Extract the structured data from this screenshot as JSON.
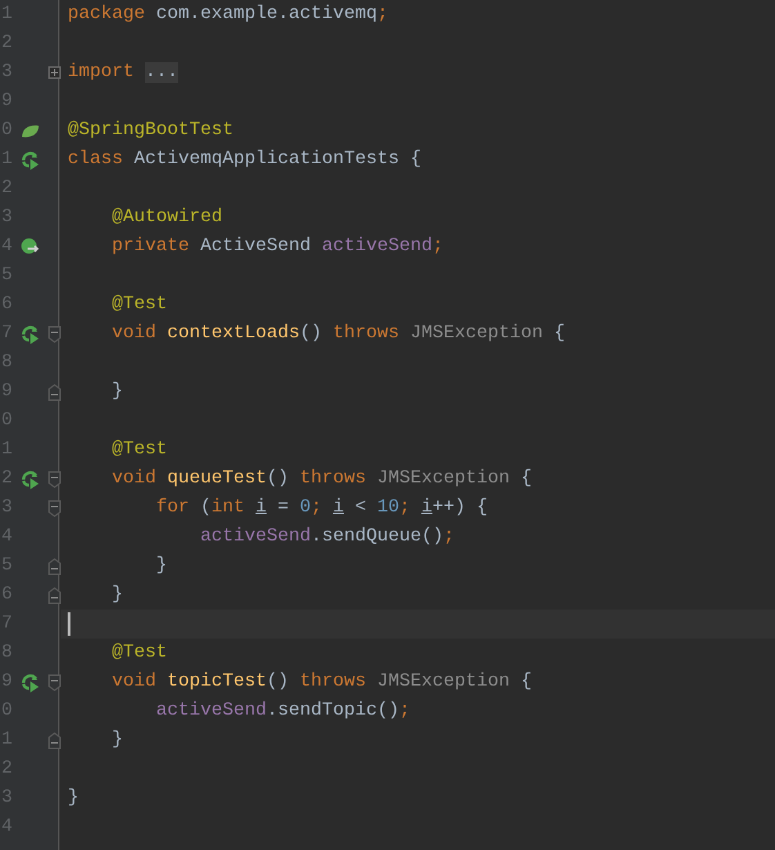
{
  "editor": {
    "lines": [
      {
        "number": "1",
        "tokens": [
          {
            "text": "package ",
            "kind": "keyword"
          },
          {
            "text": "com.example.activemq",
            "kind": "plain"
          },
          {
            "text": ";",
            "kind": "keyword"
          }
        ]
      },
      {
        "number": "2"
      },
      {
        "number": "3",
        "fold": {
          "kind": "plus"
        },
        "tokens": [
          {
            "text": "import ",
            "kind": "keyword"
          },
          {
            "text": "...",
            "kind": "folded"
          }
        ]
      },
      {
        "number": "9"
      },
      {
        "number": "0",
        "gutter": {
          "kind": "spring"
        },
        "tokens": [
          {
            "text": "@SpringBootTest",
            "kind": "annotation"
          }
        ]
      },
      {
        "number": "1",
        "gutter": {
          "kind": "run"
        },
        "tokens": [
          {
            "text": "class ",
            "kind": "keyword"
          },
          {
            "text": "ActivemqApplicationTests {",
            "kind": "plain"
          }
        ]
      },
      {
        "number": "2"
      },
      {
        "number": "3",
        "tokens": [
          {
            "text": "    @Autowired",
            "kind": "annotation"
          }
        ]
      },
      {
        "number": "4",
        "gutter": {
          "kind": "autowired"
        },
        "tokens": [
          {
            "text": "    private ",
            "kind": "keyword"
          },
          {
            "text": "ActiveSend ",
            "kind": "plain"
          },
          {
            "text": "activeSend",
            "kind": "field"
          },
          {
            "text": ";",
            "kind": "keyword"
          }
        ]
      },
      {
        "number": "5"
      },
      {
        "number": "6",
        "tokens": [
          {
            "text": "    @Test",
            "kind": "annotation"
          }
        ]
      },
      {
        "number": "7",
        "gutter": {
          "kind": "run"
        },
        "fold": {
          "kind": "start"
        },
        "tokens": [
          {
            "text": "    void ",
            "kind": "keyword"
          },
          {
            "text": "contextLoads",
            "kind": "method"
          },
          {
            "text": "() ",
            "kind": "plain"
          },
          {
            "text": "throws ",
            "kind": "keyword"
          },
          {
            "text": "JMSException",
            "kind": "unresolved"
          },
          {
            "text": " {",
            "kind": "plain"
          }
        ]
      },
      {
        "number": "8"
      },
      {
        "number": "9",
        "fold": {
          "kind": "end"
        },
        "tokens": [
          {
            "text": "    }",
            "kind": "plain"
          }
        ]
      },
      {
        "number": "0"
      },
      {
        "number": "1",
        "tokens": [
          {
            "text": "    @Test",
            "kind": "annotation"
          }
        ]
      },
      {
        "number": "2",
        "gutter": {
          "kind": "run"
        },
        "fold": {
          "kind": "start"
        },
        "tokens": [
          {
            "text": "    void ",
            "kind": "keyword"
          },
          {
            "text": "queueTest",
            "kind": "method"
          },
          {
            "text": "() ",
            "kind": "plain"
          },
          {
            "text": "throws ",
            "kind": "keyword"
          },
          {
            "text": "JMSException",
            "kind": "unresolved"
          },
          {
            "text": " {",
            "kind": "plain"
          }
        ]
      },
      {
        "number": "3",
        "fold": {
          "kind": "start"
        },
        "tokens": [
          {
            "text": "        for ",
            "kind": "keyword"
          },
          {
            "text": "(",
            "kind": "plain"
          },
          {
            "text": "int ",
            "kind": "keyword"
          },
          {
            "text": "i",
            "kind": "reassigned"
          },
          {
            "text": " = ",
            "kind": "plain"
          },
          {
            "text": "0",
            "kind": "number"
          },
          {
            "text": "; ",
            "kind": "keyword"
          },
          {
            "text": "i",
            "kind": "reassigned"
          },
          {
            "text": " < ",
            "kind": "plain"
          },
          {
            "text": "10",
            "kind": "number"
          },
          {
            "text": "; ",
            "kind": "keyword"
          },
          {
            "text": "i",
            "kind": "reassigned"
          },
          {
            "text": "++) {",
            "kind": "plain"
          }
        ]
      },
      {
        "number": "4",
        "tokens": [
          {
            "text": "            activeSend",
            "kind": "field"
          },
          {
            "text": ".sendQueue()",
            "kind": "plain"
          },
          {
            "text": ";",
            "kind": "keyword"
          }
        ]
      },
      {
        "number": "5",
        "fold": {
          "kind": "end"
        },
        "tokens": [
          {
            "text": "        }",
            "kind": "plain"
          }
        ]
      },
      {
        "number": "6",
        "fold": {
          "kind": "end"
        },
        "tokens": [
          {
            "text": "    }",
            "kind": "plain"
          }
        ]
      },
      {
        "number": "7",
        "current": true
      },
      {
        "number": "8",
        "tokens": [
          {
            "text": "    @Test",
            "kind": "annotation"
          }
        ]
      },
      {
        "number": "9",
        "gutter": {
          "kind": "run"
        },
        "fold": {
          "kind": "start"
        },
        "tokens": [
          {
            "text": "    void ",
            "kind": "keyword"
          },
          {
            "text": "topicTest",
            "kind": "method"
          },
          {
            "text": "() ",
            "kind": "plain"
          },
          {
            "text": "throws ",
            "kind": "keyword"
          },
          {
            "text": "JMSException",
            "kind": "unresolved"
          },
          {
            "text": " {",
            "kind": "plain"
          }
        ]
      },
      {
        "number": "0",
        "tokens": [
          {
            "text": "        activeSend",
            "kind": "field"
          },
          {
            "text": ".sendTopic()",
            "kind": "plain"
          },
          {
            "text": ";",
            "kind": "keyword"
          }
        ]
      },
      {
        "number": "1",
        "fold": {
          "kind": "end"
        },
        "tokens": [
          {
            "text": "    }",
            "kind": "plain"
          }
        ]
      },
      {
        "number": "2"
      },
      {
        "number": "3",
        "tokens": [
          {
            "text": "}",
            "kind": "plain"
          }
        ]
      },
      {
        "number": "4"
      }
    ]
  }
}
